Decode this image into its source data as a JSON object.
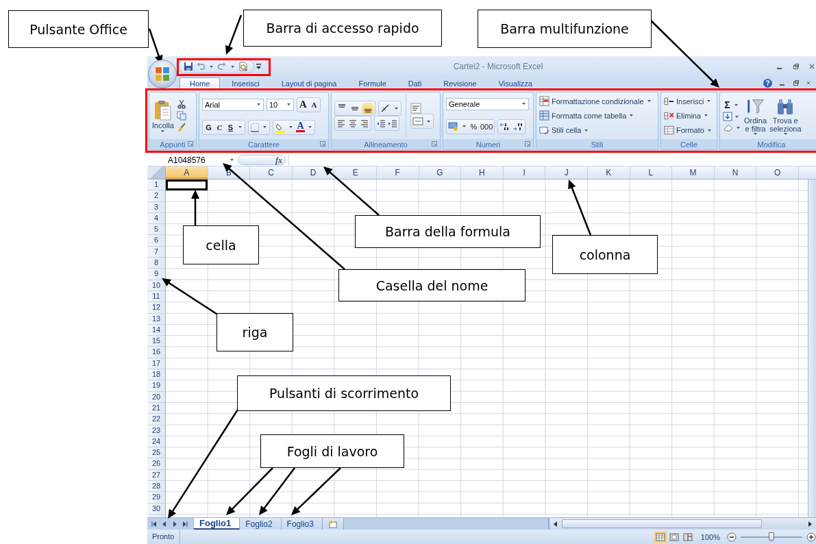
{
  "annotations": [
    {
      "text": "Pulsante Office"
    },
    {
      "text": "Barra di accesso rapido"
    },
    {
      "text": "Barra multifunzione"
    },
    {
      "text": "cella"
    },
    {
      "text": "Barra della formula"
    },
    {
      "text": "colonna"
    },
    {
      "text": "Casella del nome"
    },
    {
      "text": "riga"
    },
    {
      "text": "Pulsanti di scorrimento"
    },
    {
      "text": "Fogli di lavoro"
    }
  ],
  "window": {
    "title": "Cartel2 - Microsoft Excel",
    "help": "?"
  },
  "tabs": [
    {
      "label": "Home",
      "selected": true
    },
    {
      "label": "Inserisci",
      "selected": false
    },
    {
      "label": "Layout di pagina",
      "selected": false
    },
    {
      "label": "Formule",
      "selected": false
    },
    {
      "label": "Dati",
      "selected": false
    },
    {
      "label": "Revisione",
      "selected": false
    },
    {
      "label": "Visualizza",
      "selected": false
    }
  ],
  "ribbon": {
    "clipboard": {
      "label": "Appunti",
      "paste": "Incolla"
    },
    "font": {
      "label": "Carattere",
      "font_name": "Arial",
      "font_size": "10",
      "grow": "A",
      "shrink": "A",
      "bold": "G",
      "italic": "C",
      "underline": "S",
      "font_color": "A"
    },
    "alignment": {
      "label": "Allineamento",
      "vertical": [
        {
          "selected": false
        },
        {
          "selected": false
        },
        {
          "selected": true
        }
      ]
    },
    "number": {
      "label": "Numeri",
      "format": "Generale",
      "percent": "%",
      "thousands": "000"
    },
    "styles": {
      "label": "Stili",
      "items": [
        "Formattazione condizionale",
        "Formatta come tabella",
        "Stili cella"
      ]
    },
    "cells": {
      "label": "Celle",
      "items": [
        "Inserisci",
        "Elimina",
        "Formato"
      ]
    },
    "editing": {
      "label": "Modifica",
      "sum": "Σ",
      "sort": [
        "Ordina",
        "e filtra"
      ],
      "find": [
        "Trova e",
        "seleziona"
      ]
    }
  },
  "formula_bar": {
    "name_box": "A1048576",
    "fx": "fx"
  },
  "columns": [
    {
      "label": "A",
      "selected": true
    },
    {
      "label": "B",
      "selected": false
    },
    {
      "label": "C",
      "selected": false
    },
    {
      "label": "D",
      "selected": false
    },
    {
      "label": "E",
      "selected": false
    },
    {
      "label": "F",
      "selected": false
    },
    {
      "label": "G",
      "selected": false
    },
    {
      "label": "H",
      "selected": false
    },
    {
      "label": "I",
      "selected": false
    },
    {
      "label": "J",
      "selected": false
    },
    {
      "label": "K",
      "selected": false
    },
    {
      "label": "L",
      "selected": false
    },
    {
      "label": "M",
      "selected": false
    },
    {
      "label": "N",
      "selected": false
    },
    {
      "label": "O",
      "selected": false
    }
  ],
  "rows": [
    "1",
    "2",
    "3",
    "4",
    "5",
    "6",
    "7",
    "8",
    "9",
    "10",
    "11",
    "12",
    "13",
    "14",
    "15",
    "16",
    "17",
    "18",
    "19",
    "20",
    "21",
    "22",
    "23",
    "24",
    "25",
    "26",
    "27",
    "28",
    "29",
    "30"
  ],
  "sheets": [
    {
      "label": "Foglio1",
      "selected": true
    },
    {
      "label": "Foglio2",
      "selected": false
    },
    {
      "label": "Foglio3",
      "selected": false
    }
  ],
  "status_bar": {
    "status": "Pronto",
    "zoom_text": "100%",
    "zoom_slider": {
      "level": 0.5
    }
  }
}
